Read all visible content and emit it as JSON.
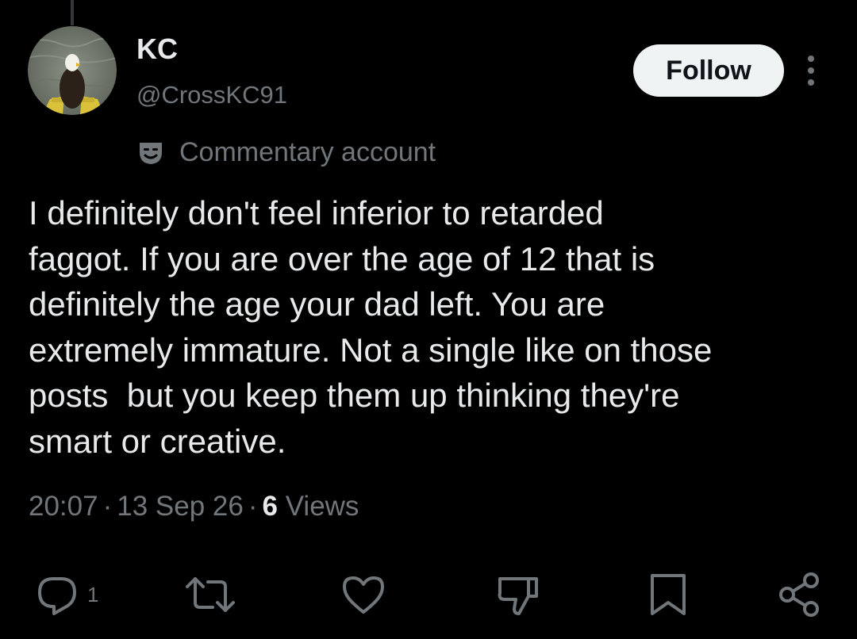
{
  "author": {
    "display_name": "KC",
    "handle": "@CrossKC91",
    "avatar": "bald-eagle-avatar"
  },
  "follow_button": {
    "label": "Follow"
  },
  "more_menu": {
    "icon": "more-vertical-icon"
  },
  "commentary": {
    "icon": "theater-masks-icon",
    "label": "Commentary account"
  },
  "tweet": {
    "text": "I definitely don't feel inferior to retarded\nfaggot. If you are over the age of 12 that is\ndefinitely the age your dad left. You are\nextremely immature. Not a single like on those\nposts  but you keep them up thinking they're\nsmart or creative."
  },
  "meta": {
    "time": "20:07",
    "separator": "·",
    "date": "13 Sep 26",
    "views_count": "6",
    "views_label": "Views"
  },
  "actions": {
    "reply": {
      "icon": "reply-icon",
      "count": "1"
    },
    "repost": {
      "icon": "repost-icon"
    },
    "like": {
      "icon": "heart-icon"
    },
    "dislike": {
      "icon": "thumbs-down-icon"
    },
    "bookmark": {
      "icon": "bookmark-icon"
    },
    "share": {
      "icon": "share-icon"
    }
  },
  "colors": {
    "background": "#000000",
    "text_primary": "#e7e9ea",
    "text_secondary": "#71767b",
    "follow_bg": "#eff3f4"
  }
}
